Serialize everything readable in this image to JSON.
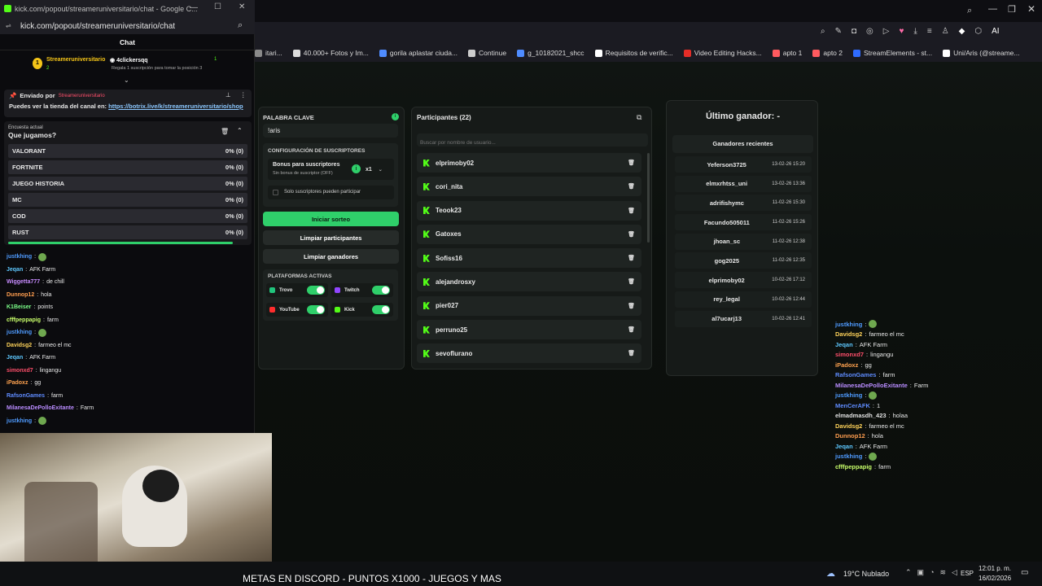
{
  "browser_top": {
    "title": "kick.com/popout/streameruniversitario/chat - Google C..."
  },
  "bookmarks": [
    {
      "label": "itari...",
      "color": "#8a8a8a"
    },
    {
      "label": "40.000+ Fotos y Im...",
      "color": "#dddddd"
    },
    {
      "label": "gorila aplastar ciuda...",
      "color": "#4f8cff"
    },
    {
      "label": "Continue",
      "color": "#cccccc"
    },
    {
      "label": "g_10182021_shcc",
      "color": "#4f8cff"
    },
    {
      "label": "Requisitos de verific...",
      "color": "#ffffff"
    },
    {
      "label": "Video Editing Hacks...",
      "color": "#e52d27"
    },
    {
      "label": "apto 1",
      "color": "#ff5a5f"
    },
    {
      "label": "apto 2",
      "color": "#ff5a5f"
    },
    {
      "label": "StreamElements - st...",
      "color": "#2f6cff"
    },
    {
      "label": "Uni/Aris (@streame...",
      "color": "#ffffff"
    }
  ],
  "chat": {
    "url": "kick.com/popout/streameruniversitario/chat",
    "header": "Chat",
    "leader1": "Streameruniversitario",
    "leader1_count": "2",
    "leader2": "4clickersqq",
    "leader2_count": "1",
    "leader_note": "Regala 1 suscripción para tomar la posición 3",
    "pinned_by": "Enviado por",
    "pinned_user": "Streameruniversitario",
    "pinned_text_pre": "Puedes ver la tienda del canal en: ",
    "pinned_link": "https://botrix.live/k/streameruniversitario/shop",
    "poll_label": "Encuesta actual",
    "poll_question": "Que jugamos?",
    "poll_options": [
      {
        "name": "VALORANT",
        "pct": "0% (0)"
      },
      {
        "name": "FORTNITE",
        "pct": "0% (0)"
      },
      {
        "name": "JUEGO HISTORIA",
        "pct": "0% (0)"
      },
      {
        "name": "MC",
        "pct": "0% (0)"
      },
      {
        "name": "COD",
        "pct": "0% (0)"
      },
      {
        "name": "RUST",
        "pct": "0% (0)"
      }
    ],
    "messages": [
      {
        "user": "justkhing",
        "color": "#4f9bff",
        "text": "",
        "emote": true
      },
      {
        "user": "Jeqan",
        "color": "#5ec8ff",
        "text": "AFK Farm"
      },
      {
        "user": "Wiggetta777",
        "color": "#c88cff",
        "text": "de chill"
      },
      {
        "user": "Dunnop12",
        "color": "#ff9e4f",
        "text": "hola"
      },
      {
        "user": "K1Beiser",
        "color": "#7cff8a",
        "text": "points"
      },
      {
        "user": "cfffpeppapig",
        "color": "#c9ff6b",
        "text": "farm"
      },
      {
        "user": "justkhing",
        "color": "#4f9bff",
        "text": "",
        "emote": true
      },
      {
        "user": "Davidsg2",
        "color": "#ffd35a",
        "text": "farmeo el mc"
      },
      {
        "user": "Jeqan",
        "color": "#5ec8ff",
        "text": "AFK Farm"
      },
      {
        "user": "simonxd7",
        "color": "#ff4f6b",
        "text": "lingangu"
      },
      {
        "user": "iPadoxz",
        "color": "#ffa24f",
        "text": "gg"
      },
      {
        "user": "RafsonGames",
        "color": "#5f8cff",
        "text": "farm"
      },
      {
        "user": "MilanesaDePolloExitante",
        "color": "#b98cff",
        "text": "Farm"
      },
      {
        "user": "justkhing",
        "color": "#4f9bff",
        "text": "",
        "emote": true
      }
    ]
  },
  "keyword": {
    "label": "PALABRA CLAVE",
    "value": "!aris"
  },
  "subs": {
    "section": "CONFIGURACIÓN DE SUSCRIPTORES",
    "bonus_title": "Bonus para suscriptores",
    "bonus_sub": "Sin bonus de suscriptor (OFF)",
    "multiplier": "x1",
    "only_subs": "Solo suscriptores pueden participar"
  },
  "buttons": {
    "start": "Iniciar sorteo",
    "clear_participants": "Limpiar participantes",
    "clear_winners": "Limpiar ganadores"
  },
  "platforms": {
    "section": "PLATAFORMAS ACTIVAS",
    "items": [
      {
        "name": "Trovo",
        "color": "#21c47c"
      },
      {
        "name": "Twitch",
        "color": "#9146ff"
      },
      {
        "name": "YouTube",
        "color": "#ff2d2d"
      },
      {
        "name": "Kick",
        "color": "#53fc18"
      }
    ]
  },
  "participants": {
    "title": "Participantes (22)",
    "search_placeholder": "Buscar por nombre de usuario...",
    "list": [
      "elprimoby02",
      "cori_nita",
      "Teook23",
      "Gatoxes",
      "Sofiss16",
      "alejandrosxy",
      "pier027",
      "perruno25",
      "sevoflurano"
    ]
  },
  "winners": {
    "last": "Último ganador: -",
    "recent_title": "Ganadores recientes",
    "list": [
      {
        "name": "Yeferson3725",
        "date": "13-02-26 15:20"
      },
      {
        "name": "elmxrhtss_uni",
        "date": "13-02-26 13:36"
      },
      {
        "name": "adrifishymc",
        "date": "11-02-26 15:30"
      },
      {
        "name": "Facundo505011",
        "date": "11-02-26 15:26"
      },
      {
        "name": "jhoan_sc",
        "date": "11-02-26 12:38"
      },
      {
        "name": "gog2025",
        "date": "11-02-26 12:35"
      },
      {
        "name": "elprimoby02",
        "date": "10-02-26 17:12"
      },
      {
        "name": "rey_legal",
        "date": "10-02-26 12:44"
      },
      {
        "name": "al7ucarj13",
        "date": "10-02-26 12:41"
      }
    ]
  },
  "right_chat": [
    {
      "user": "justkhing",
      "color": "#4f9bff",
      "text": "",
      "emote": true
    },
    {
      "user": "Davidsg2",
      "color": "#ffd35a",
      "text": "farmeo el mc"
    },
    {
      "user": "Jeqan",
      "color": "#5ec8ff",
      "text": "AFK Farm"
    },
    {
      "user": "simonxd7",
      "color": "#ff4f6b",
      "text": "lingangu"
    },
    {
      "user": "iPadoxz",
      "color": "#ffa24f",
      "text": "gg"
    },
    {
      "user": "RafsonGames",
      "color": "#5f8cff",
      "text": "farm"
    },
    {
      "user": "MilanesaDePolloExitante",
      "color": "#b98cff",
      "text": "Farm"
    },
    {
      "user": "justkhing",
      "color": "#4f9bff",
      "text": "",
      "emote": true
    },
    {
      "user": "MenCerAFK",
      "color": "#5f8cff",
      "text": "1"
    },
    {
      "user": "elmadmasdh_423",
      "color": "#e0e0e0",
      "text": "holaa"
    },
    {
      "user": "Davidsg2",
      "color": "#ffd35a",
      "text": "farmeo el mc"
    },
    {
      "user": "Dunnop12",
      "color": "#ff9e4f",
      "text": "hola"
    },
    {
      "user": "Jeqan",
      "color": "#5ec8ff",
      "text": "AFK Farm"
    },
    {
      "user": "justkhing",
      "color": "#4f9bff",
      "text": "",
      "emote": true
    },
    {
      "user": "cfffpeppapig",
      "color": "#c9ff6b",
      "text": "farm"
    }
  ],
  "taskbar": {
    "weather": "19°C Nublado",
    "lang": "ESP",
    "time": "12:01 p. m.",
    "date": "16/02/2026"
  },
  "ticker": "METAS EN DISCORD - PUNTOS X1000 - JUEGOS Y MAS",
  "colors": {
    "accent": "#2fcf6a",
    "kick": "#53fc18"
  }
}
